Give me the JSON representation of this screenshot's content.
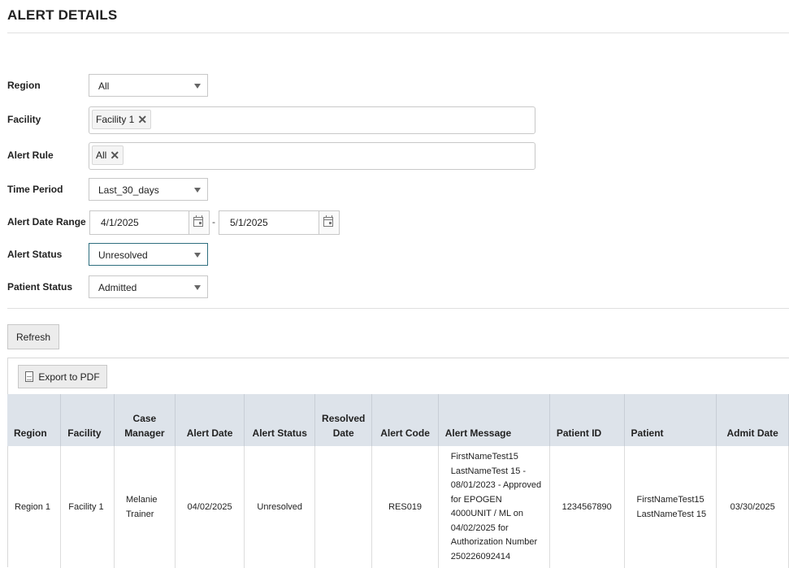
{
  "page": {
    "title": "ALERT DETAILS"
  },
  "filters": {
    "region": {
      "label": "Region",
      "value": "All"
    },
    "facility": {
      "label": "Facility",
      "tags": [
        "Facility 1"
      ]
    },
    "alert_rule": {
      "label": "Alert Rule",
      "tags": [
        "All"
      ]
    },
    "time_period": {
      "label": "Time Period",
      "value": "Last_30_days"
    },
    "alert_date_range": {
      "label": "Alert Date Range",
      "from": "4/1/2025",
      "separator": "-",
      "to": "5/1/2025"
    },
    "alert_status": {
      "label": "Alert Status",
      "value": "Unresolved"
    },
    "patient_status": {
      "label": "Patient Status",
      "value": "Admitted"
    }
  },
  "actions": {
    "refresh_label": "Refresh",
    "export_pdf_label": "Export to PDF"
  },
  "table": {
    "columns": [
      "Region",
      "Facility",
      "Case Manager",
      "Alert Date",
      "Alert Status",
      "Resolved Date",
      "Alert Code",
      "Alert Message",
      "Patient ID",
      "Patient",
      "Admit Date"
    ],
    "rows": [
      {
        "region": "Region 1",
        "facility": "Facility 1",
        "case_manager": "Melanie Trainer",
        "alert_date": "04/02/2025",
        "alert_status": "Unresolved",
        "resolved_date": "",
        "alert_code": "RES019",
        "alert_message": "FirstNameTest15 LastNameTest 15 - 08/01/2023 - Approved for EPOGEN 4000UNIT / ML on 04/02/2025 for Authorization Number 250226092414",
        "patient_id": "1234567890",
        "patient": "FirstNameTest15 LastNameTest 15",
        "admit_date": "03/30/2025"
      }
    ]
  },
  "colors": {
    "header_bg": "#dde3ea",
    "focus_border": "#2f6f7f"
  }
}
